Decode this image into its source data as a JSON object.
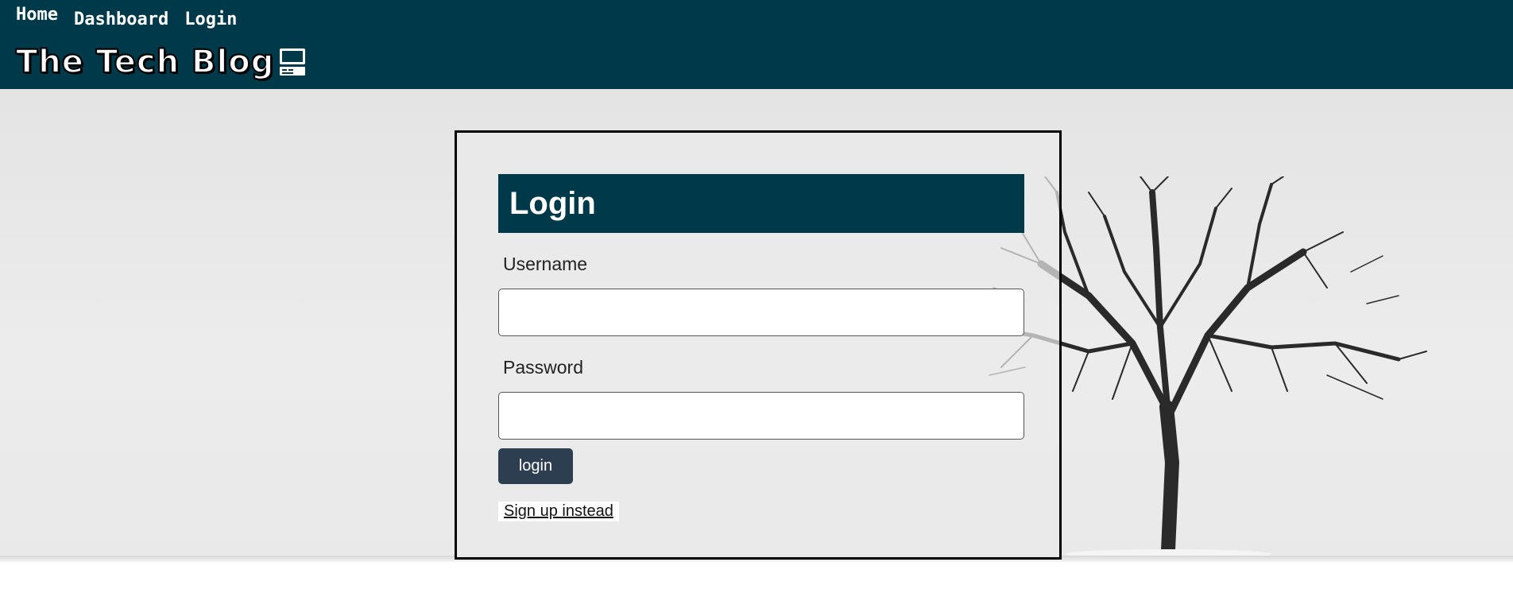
{
  "nav": {
    "items": [
      "Home",
      "Dashboard",
      "Login"
    ]
  },
  "brand": {
    "title": "The Tech Blog"
  },
  "login_form": {
    "title": "Login",
    "username_label": "Username",
    "username_value": "",
    "password_label": "Password",
    "password_value": "",
    "login_button_label": "login",
    "signup_link_label": "Sign up instead"
  },
  "colors": {
    "header_bg": "#003a4a",
    "title_bar_bg": "#003a4a",
    "button_bg": "#2c3e50"
  },
  "icons": {
    "brand_icon": "computer-icon"
  }
}
